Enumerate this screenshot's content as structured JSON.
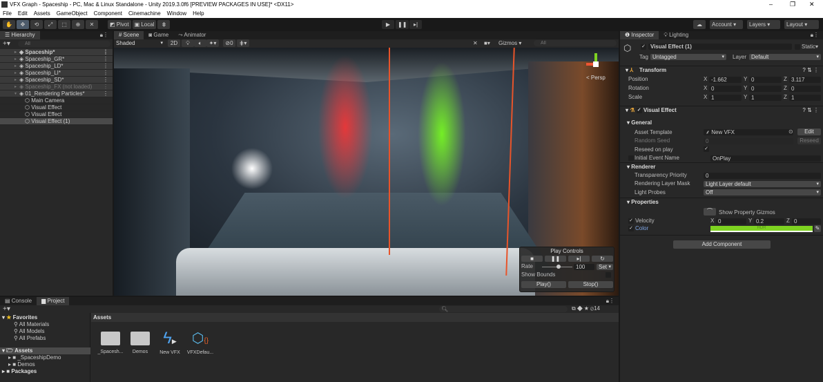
{
  "window": {
    "title": "VFX Graph - Spaceship - PC, Mac & Linux Standalone - Unity 2019.3.0f6 [PREVIEW PACKAGES IN USE]* <DX11>",
    "min": "–",
    "max": "❐",
    "close": "✕"
  },
  "menu": [
    "File",
    "Edit",
    "Assets",
    "GameObject",
    "Component",
    "Cinemachine",
    "Window",
    "Help"
  ],
  "toolbar": {
    "pivot": "Pivot",
    "local": "Local",
    "account": "Account",
    "layers": "Layers",
    "layout": "Layout"
  },
  "hierarchy": {
    "tab": "Hierarchy",
    "search_placeholder": "All",
    "items": [
      {
        "label": "Spaceship*",
        "indent": 0,
        "bold": true
      },
      {
        "label": "Spaceship_GR*",
        "indent": 0
      },
      {
        "label": "Spaceship_LD*",
        "indent": 0
      },
      {
        "label": "Spaceship_LI*",
        "indent": 0
      },
      {
        "label": "Spaceship_SD*",
        "indent": 0
      },
      {
        "label": "Spaceship_FX (not loaded)",
        "indent": 0,
        "dim": true
      },
      {
        "label": "01_Rendering Particles*",
        "indent": 0
      },
      {
        "label": "Main Camera",
        "indent": 1
      },
      {
        "label": "Visual Effect",
        "indent": 1
      },
      {
        "label": "Visual Effect",
        "indent": 1
      },
      {
        "label": "Visual Effect (1)",
        "indent": 1,
        "selected": true
      }
    ]
  },
  "scene": {
    "tabs": [
      "Scene",
      "Game",
      "Animator"
    ],
    "shading": "Shaded",
    "mode2d": "2D",
    "hidden_count": "0",
    "gizmos": "Gizmos",
    "search_placeholder": "All",
    "persp": "< Persp"
  },
  "play_controls": {
    "title": "Play Controls",
    "rate_label": "Rate",
    "rate_value": "100",
    "rate_fraction": 0.55,
    "set": "Set",
    "show_bounds": "Show Bounds",
    "play": "Play()",
    "stop": "Stop()"
  },
  "inspector": {
    "tabs": [
      "Inspector",
      "Lighting"
    ],
    "object_name": "Visual Effect (1)",
    "static": "Static",
    "tag_label": "Tag",
    "tag": "Untagged",
    "layer_label": "Layer",
    "layer": "Default",
    "transform": {
      "title": "Transform",
      "position": {
        "label": "Position",
        "x": "-1.662",
        "y": "0",
        "z": "3.117"
      },
      "rotation": {
        "label": "Rotation",
        "x": "0",
        "y": "0",
        "z": "0"
      },
      "scale": {
        "label": "Scale",
        "x": "1",
        "y": "1",
        "z": "1"
      }
    },
    "vfx": {
      "title": "Visual Effect",
      "general": "General",
      "asset_template_label": "Asset Template",
      "asset_template": "New VFX",
      "edit": "Edit",
      "random_seed_label": "Random Seed",
      "random_seed": "0",
      "reseed": "Reseed",
      "reseed_on_play": "Reseed on play",
      "initial_event_label": "Initial Event Name",
      "initial_event": "OnPlay",
      "renderer": "Renderer",
      "transparency_label": "Transparency Priority",
      "transparency": "0",
      "layer_mask_label": "Rendering Layer Mask",
      "layer_mask": "Light Layer default",
      "light_probes_label": "Light Probes",
      "light_probes": "Off",
      "properties": "Properties",
      "show_gizmos": "Show Property Gizmos",
      "velocity_label": "Velocity",
      "velocity": {
        "x": "0",
        "y": "0.2",
        "z": "0"
      },
      "color_label": "Color",
      "color_value": "#7ed321",
      "hdr": "HDR"
    },
    "add_component": "Add Component"
  },
  "bottom": {
    "tabs": [
      "Console",
      "Project"
    ],
    "count": "14",
    "favorites": "Favorites",
    "fav_items": [
      "All Materials",
      "All Models",
      "All Prefabs"
    ],
    "assets": "Assets",
    "asset_children": [
      "_SpaceshipDemo",
      "Demos"
    ],
    "packages": "Packages",
    "breadcrumb": "Assets",
    "files": [
      "_Spacesh...",
      "Demos",
      "New VFX",
      "VFXDefau..."
    ]
  },
  "colors": {
    "accent": "#4d78cc",
    "selected": "#4a4a4a"
  }
}
